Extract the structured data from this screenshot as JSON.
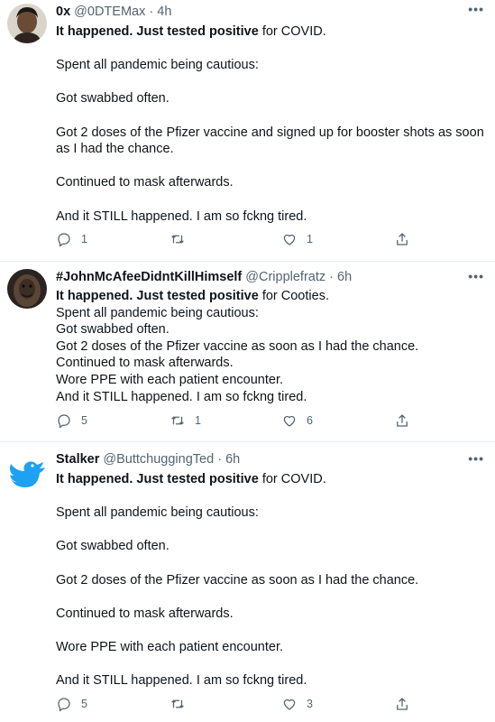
{
  "tweets": [
    {
      "name": "0x",
      "handle": "@0DTEMax",
      "sep": "·",
      "time": "4h",
      "more": "•••",
      "bold_lead": "It happened. Just tested positive",
      "lead_rest": " for COVID.",
      "lines": [
        "Spent all pandemic being cautious:",
        "Got swabbed often.",
        "Got 2 doses of the Pfizer vaccine and signed up for booster shots as soon as I had the chance.",
        "Continued to mask afterwards.",
        "And it STILL happened. I am so fckng tired."
      ],
      "replies": "1",
      "retweets": "",
      "likes": "1",
      "avatar": {
        "icon": "person-photo",
        "bg": "#d9d4cc",
        "face": "#6b4a36",
        "hair": "#1f1712"
      }
    },
    {
      "name": "#JohnMcAfeeDidntKillHimself",
      "handle": "@Cripplefratz",
      "sep": "·",
      "time": "6h",
      "more": "•••",
      "bold_lead": "It happened. Just tested positive",
      "lead_rest": " for Cooties.",
      "lines": [
        "Spent all pandemic being cautious:",
        "Got swabbed often.",
        "Got 2 doses of the Pfizer vaccine as soon as I had the chance.",
        "Continued to mask afterwards.",
        "Wore PPE with each patient encounter.",
        "And it STILL happened. I am so fckng tired."
      ],
      "replies": "5",
      "retweets": "1",
      "likes": "6",
      "avatar": {
        "icon": "chewbacca-photo",
        "bg": "#2a2420",
        "fur": "#5a4636"
      }
    },
    {
      "name": "Stalker",
      "handle": "@ButtchuggingTed",
      "sep": "·",
      "time": "6h",
      "more": "•••",
      "bold_lead": "It happened. Just tested positive",
      "lead_rest": " for COVID.",
      "lines": [
        "Spent all pandemic being cautious:",
        "Got swabbed often.",
        "Got 2 doses of the Pfizer vaccine as soon as I had the chance.",
        "Continued to mask afterwards.",
        "Wore PPE with each patient encounter.",
        "And it STILL happened. I am so fckng tired."
      ],
      "replies": "5",
      "retweets": "",
      "likes": "3",
      "avatar": {
        "icon": "twitter-bird-icon",
        "bg": "#ffffff",
        "bird": "#1da1f2"
      }
    }
  ],
  "colors": {
    "text": "#0f1419",
    "secondary": "#536471",
    "divider": "#e6ecf0"
  }
}
